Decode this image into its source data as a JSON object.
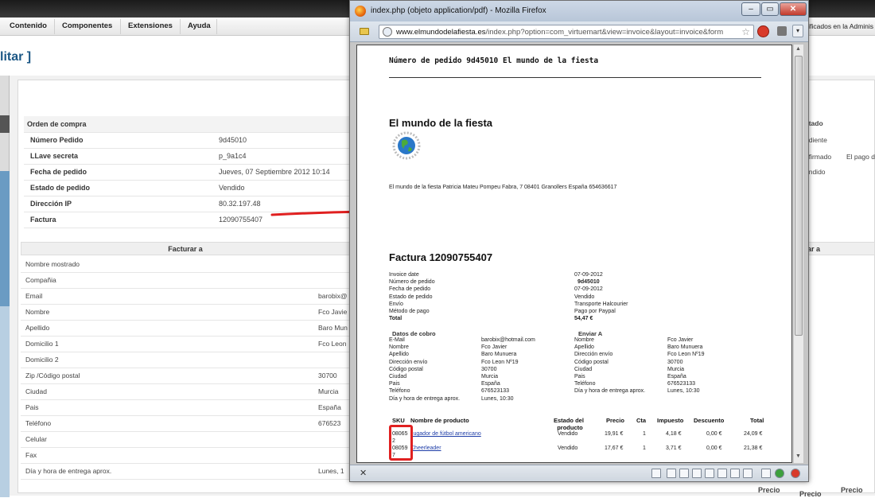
{
  "admin": {
    "menu": [
      "Contenido",
      "Componentes",
      "Extensiones",
      "Ayuda"
    ],
    "topright_text": "ificados en la Adminis",
    "page_title": "litar ]",
    "order_section_title": "Orden de compra",
    "order_rows": [
      {
        "label": "Número Pedido",
        "value": "9d45010"
      },
      {
        "label": "LLave secreta",
        "value": "p_9a1c4"
      },
      {
        "label": "Fecha de pedido",
        "value": "Jueves, 07 Septiembre 2012 10:14"
      },
      {
        "label": "Estado de pedido",
        "value": "Vendido"
      },
      {
        "label": "Dirección IP",
        "value": "80.32.197.48"
      },
      {
        "label": "Factura",
        "value": "12090755407"
      }
    ],
    "bill_header": "Facturar a",
    "bill_rows": [
      {
        "label": "Nombre mostrado",
        "value": ""
      },
      {
        "label": "Compañia",
        "value": ""
      },
      {
        "label": "Email",
        "value": "barobix@"
      },
      {
        "label": "Nombre",
        "value": "Fco Javie"
      },
      {
        "label": "Apellido",
        "value": "Baro Mun"
      },
      {
        "label": "Domicilio 1",
        "value": "Fco Leon"
      },
      {
        "label": "Domicilio 2",
        "value": ""
      },
      {
        "label": "Zip /Código postal",
        "value": "30700"
      },
      {
        "label": "Ciudad",
        "value": "Murcia"
      },
      {
        "label": "Pais",
        "value": "España"
      },
      {
        "label": "Teléfono",
        "value": "676523"
      },
      {
        "label": "Celular",
        "value": ""
      },
      {
        "label": "Fax",
        "value": ""
      },
      {
        "label": "Día y hora de entrega aprox.",
        "value": "Lunes, 1"
      }
    ],
    "right_col": {
      "status_header": "stado",
      "status_rows": [
        "ndiente",
        "nfirmado",
        "endido"
      ],
      "status_note": "El pago d",
      "bill_header": "ar a"
    },
    "precio_labels": [
      "Precio",
      "Precio",
      "Precio"
    ]
  },
  "firefox": {
    "title": "index.php (objeto application/pdf) - Mozilla Firefox",
    "url_domain": "www.elmundodelafiesta.es",
    "url_path": "/index.php?option=com_virtuemart&view=invoice&layout=invoice&form",
    "win_min": "–",
    "win_max": "▭",
    "win_close": "✕",
    "star": "☆",
    "menu_arrow": "▾",
    "statusbar_close": "✕"
  },
  "pdf": {
    "title": "Número de pedido 9d45010 El mundo de la fiesta",
    "shop_name": "El mundo de la fiesta",
    "address": "El mundo de la fiesta Patricia Mateu Pompeu Fabra, 7 08401 Granollers España 654636617",
    "invoice_title": "Factura 12090755407",
    "info": [
      {
        "label": "Invoice date",
        "value": "07-09-2012",
        "bold": false
      },
      {
        "label": "Número de pedido",
        "value": "9d45010",
        "bold": "value"
      },
      {
        "label": "Fecha de pedido",
        "value": "07-09-2012",
        "bold": false
      },
      {
        "label": "Estado de pedido",
        "value": "Vendido",
        "bold": false
      },
      {
        "label": "Envío",
        "value": "Transporte Halcourier",
        "bold": false
      },
      {
        "label": "Método de pago",
        "value": "Pago por Paypal",
        "bold": false
      },
      {
        "label": "Total",
        "value": "54,47 €",
        "bold": "both"
      }
    ],
    "cobro_title": "Datos de cobro",
    "enviar_title": "Enviar A",
    "cobro": [
      {
        "label": "E-Mail",
        "value": "barobix@hotmail.com"
      },
      {
        "label": "Nombre",
        "value": "Fco Javier"
      },
      {
        "label": "Apellido",
        "value": "Baro Munuera"
      },
      {
        "label": "Dirección envío",
        "value": "Fco Leon Nº19"
      },
      {
        "label": "Código postal",
        "value": "30700"
      },
      {
        "label": "Ciudad",
        "value": "Murcia"
      },
      {
        "label": "Pais",
        "value": "España"
      },
      {
        "label": "Teléfono",
        "value": "676523133"
      },
      {
        "label": "Día y hora de entrega aprox.",
        "value": "Lunes, 10:30"
      }
    ],
    "enviar": [
      {
        "label": "Nombre",
        "value": "Fco Javier"
      },
      {
        "label": "Apellido",
        "value": "Baro Munuera"
      },
      {
        "label": "Dirección envío",
        "value": "Fco Leon Nº19"
      },
      {
        "label": "Código postal",
        "value": "30700"
      },
      {
        "label": "Ciudad",
        "value": "Murcia"
      },
      {
        "label": "Pais",
        "value": "España"
      },
      {
        "label": "Teléfono",
        "value": "676523133"
      },
      {
        "label": "Día y hora de entrega aprox.",
        "value": "Lunes, 10:30"
      }
    ],
    "product_headers": {
      "sku": "SKU",
      "name": "Nombre de producto",
      "status_1": "Estado del",
      "status_2": "producto",
      "price": "Precio",
      "qty": "Cta",
      "tax": "Impuesto",
      "discount": "Descuento",
      "total": "Total"
    },
    "products": [
      {
        "sku_1": "08065",
        "sku_2": "2",
        "name": "Jugador de fútbol americano",
        "status": "Vendido",
        "price": "19,91 €",
        "qty": "1",
        "tax": "4,18 €",
        "discount": "0,00 €",
        "total": "24,09 €"
      },
      {
        "sku_1": "08059",
        "sku_2": "7",
        "name": "Cheerleader",
        "status": "Vendido",
        "price": "17,67 €",
        "qty": "1",
        "tax": "3,71 €",
        "discount": "0,00 €",
        "total": "21,38 €"
      }
    ]
  },
  "colors": {
    "annotation_red": "#e02020",
    "link_blue": "#1f5a9c"
  }
}
